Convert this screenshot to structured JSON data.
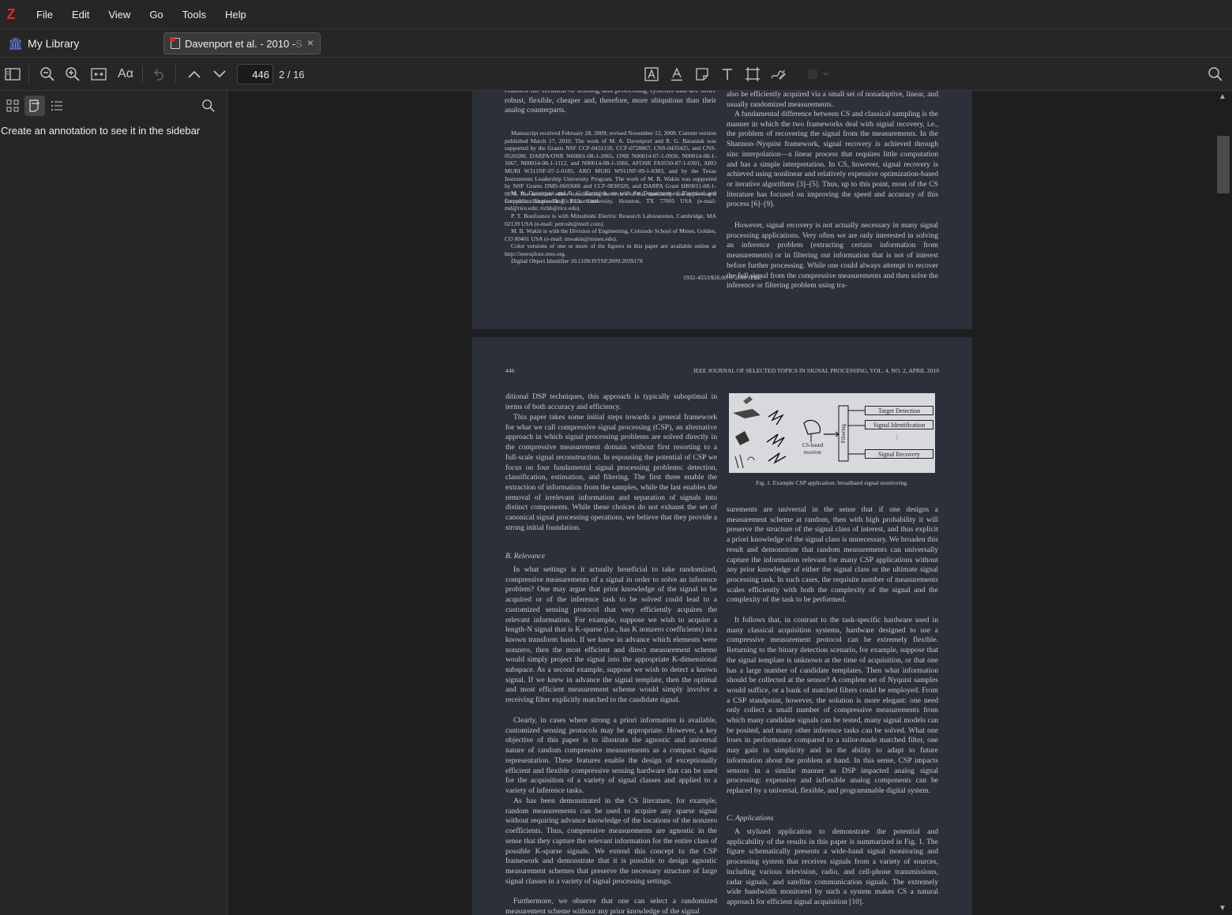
{
  "app": {
    "logo": "Z"
  },
  "menu": [
    "File",
    "Edit",
    "View",
    "Go",
    "Tools",
    "Help"
  ],
  "tabs": {
    "library": "My Library",
    "document": "Davenport et al. - 2010 - ",
    "document_fade": "S",
    "close": "×"
  },
  "toolbar": {
    "page_value": "446",
    "page_count": "2 / 16",
    "icons": [
      "sidebar-toggle-icon",
      "zoom-out-icon",
      "zoom-in-icon",
      "fit-width-icon",
      "appearance-icon",
      "undo-icon",
      "previous-page-icon",
      "next-page-icon",
      "highlight-icon",
      "underline-icon",
      "note-icon",
      "text-icon",
      "area-icon",
      "ink-icon",
      "color-icon",
      "search-icon"
    ]
  },
  "sidebar": {
    "message": "Create an annotation to see it in the sidebar"
  },
  "page1": {
    "left_top": "enabled the creation of sensing and processing systems that are more robust, flexible, cheaper and, therefore, more ubiquitous than their analog counterparts.",
    "footnote1": "Manuscript received February 28, 2009; revised November 12, 2009. Current version published March 17, 2010. The work of M. A. Davenport and R. G. Baraniuk was supported by the Grants NSF CCF-0431150, CCF-0728867, CNS-0435425, and CNS-0520280, DARPA/ONR N66001-08-1-2065, ONR N00014-07-1-0936, N00014-08-1-1067, N00014-08-1-1112, and N00014-08-1-1066, AFOSR FA9550-07-1-0301, ARO MURI W311NF-07-1-0185, ARO MURI W911NF-09-1-0383, and by the Texas Instruments Leadership University Program. The work of M. B. Wakin was supported by NSF Grants DMS-0603606 and CCF-0830320, and DARPA Grant HR0011-08-1-0078. The associate editor coordinating the review of this manuscript and approving it for publication was Dr. Rick Chartrand.",
    "footnote2": "M. A. Davenport and R. G. Baraniuk are with the Department of Electrical and Computer Engineering, Rice University, Houston, TX 77005 USA (e-mail: md@rice.edu; richb@rice.edu).",
    "footnote3": "P. T. Boufounos is with Mitsubishi Electric Research Laboratories, Cambridge, MA 02139 USA (e-mail: petrosb@merl.com).",
    "footnote4": "M. B. Wakin is with the Division of Engineering, Colorado School of Mines, Golden, CO 80401 USA (e-mail: mwakin@mines.edu).",
    "footnote5": "Color versions of one or more of the figures in this paper are available online at http://ieeexplore.ieee.org.",
    "footnote6": "Digital Object Identifier 10.1109/JSTSP.2009.2039178",
    "right_p1": "also be efficiently acquired via a small set of nonadaptive, linear, and usually randomized measurements.",
    "right_p2": "A fundamental difference between CS and classical sampling is the manner in which the two frameworks deal with signal recovery, i.e., the problem of recovering the signal from the measurements. In the Shannon–Nyquist framework, signal recovery is achieved through sinc interpolation—a linear process that requires little computation and has a simple interpretation. In CS, however, signal recovery is achieved using nonlinear and relatively expensive optimization-based or iterative algorithms [3]–[5]. Thus, up to this point, most of the CS literature has focused on improving the speed and accuracy of this process [6]–[9].",
    "right_p3": "However, signal recovery is not actually necessary in many signal processing applications. Very often we are only interested in solving an inference problem (extracting certain information from measurements) or in filtering out information that is not of interest before further processing. While one could always attempt to recover the full signal from the compressive measurements and then solve the inference or filtering problem using tra-",
    "copyright": "1932-4553/$26.00 © 2010 IEEE"
  },
  "page2": {
    "page_num": "446",
    "journal": "IEEE JOURNAL OF SELECTED TOPICS IN SIGNAL PROCESSING, VOL. 4, NO. 2, APRIL 2010",
    "left_p1": "ditional DSP techniques, this approach is typically suboptimal in terms of both accuracy and efficiency.",
    "left_p2": "This paper takes some initial steps towards a general framework for what we call compressive signal processing (CSP), an alternative approach in which signal processing problems are solved directly in the compressive measurement domain without first resorting to a full-scale signal reconstruction. In espousing the potential of CSP we focus on four fundamental signal processing problems: detection, classification, estimation, and filtering. The first three enable the extraction of information from the samples, while the last enables the removal of irrelevant information and separation of signals into distinct components. While these choices do not exhaust the set of canonical signal processing operations, we believe that they provide a strong initial foundation.",
    "heading_b": "B. Relevance",
    "left_p3": "In what settings is it actually beneficial to take randomized, compressive measurements of a signal in order to solve an inference problem? One may argue that prior knowledge of the signal to be acquired or of the inference task to be solved could lead to a customized sensing protocol that very efficiently acquires the relevant information. For example, suppose we wish to acquire a length-N signal that is K-sparse (i.e., has K nonzero coefficients) in a known transform basis. If we knew in advance which elements were nonzero, then the most efficient and direct measurement scheme would simply project the signal into the appropriate K-dimensional subspace. As a second example, suppose we wish to detect a known signal. If we knew in advance the signal template, then the optimal and most efficient measurement scheme would simply involve a receiving filter explicitly matched to the candidate signal.",
    "left_p4": "Clearly, in cases where strong a priori information is available, customized sensing protocols may be appropriate. However, a key objective of this paper is to illustrate the agnostic and universal nature of random compressive measurements as a compact signal representation. These features enable the design of exceptionally efficient and flexible compressive sensing hardware that can be used for the acquisition of a variety of signal classes and applied to a variety of inference tasks.",
    "left_p5": "As has been demonstrated in the CS literature, for example, random measurements can be used to acquire any sparse signal without requiring advance knowledge of the locations of the nonzero coefficients. Thus, compressive measurements are agnostic in the sense that they capture the relevant information for the entire class of possible K-sparse signals. We extend this concept to the CSP framework and demonstrate that it is possible to design agnostic measurement schemes that preserve the necessary structure of large signal classes in a variety of signal processing settings.",
    "left_p6": "Furthermore, we observe that one can select a randomized measurement scheme without any prior knowledge of the signal",
    "fig_labels": [
      "Target Detection",
      "Signal Identification",
      "Signal Recovery",
      "Filtering",
      "CS-based receiver"
    ],
    "fig_caption": "Fig. 1.  Example CSP application: broadband signal monitoring.",
    "right_p1": "surements are universal in the sense that if one designs a measurement scheme at random, then with high probability it will preserve the structure of the signal class of interest, and thus explicit a priori knowledge of the signal class is unnecessary. We broaden this result and demonstrate that random measurements can universally capture the information relevant for many CSP applications without any prior knowledge of either the signal class or the ultimate signal processing task. In such cases, the requisite number of measurements scales efficiently with both the complexity of the signal and the complexity of the task to be performed.",
    "right_p2": "It follows that, in contrast to the task-specific hardware used in many classical acquisition systems, hardware designed to use a compressive measurement protocol can be extremely flexible. Returning to the binary detection scenario, for example, suppose that the signal template is unknown at the time of acquisition, or that one has a large number of candidate templates. Then what information should be collected at the sensor? A complete set of Nyquist samples would suffice, or a bank of matched filters could be employed. From a CSP standpoint, however, the solution is more elegant: one need only collect a small number of compressive measurements from which many candidate signals can be tested, many signal models can be posited, and many other inference tasks can be solved. What one loses in performance compared to a tailor-made matched filter, one may gain in simplicity and in the ability to adapt to future information about the problem at hand. In this sense, CSP impacts sensors in a similar manner as DSP impacted analog signal processing: expensive and inflexible analog components can be replaced by a universal, flexible, and programmable digital system.",
    "heading_c": "C. Applications",
    "right_p3": "A stylized application to demonstrate the potential and applicability of the results in this paper is summarized in Fig. 1. The figure schematically presents a wide-band signal monitoring and processing system that receives signals from a variety of sources, including various television, radio, and cell-phone transmissions, radar signals, and satellite communication signals. The extremely wide bandwidth monitored by such a system makes CS a natural approach for efficient signal acquisition [10]."
  }
}
